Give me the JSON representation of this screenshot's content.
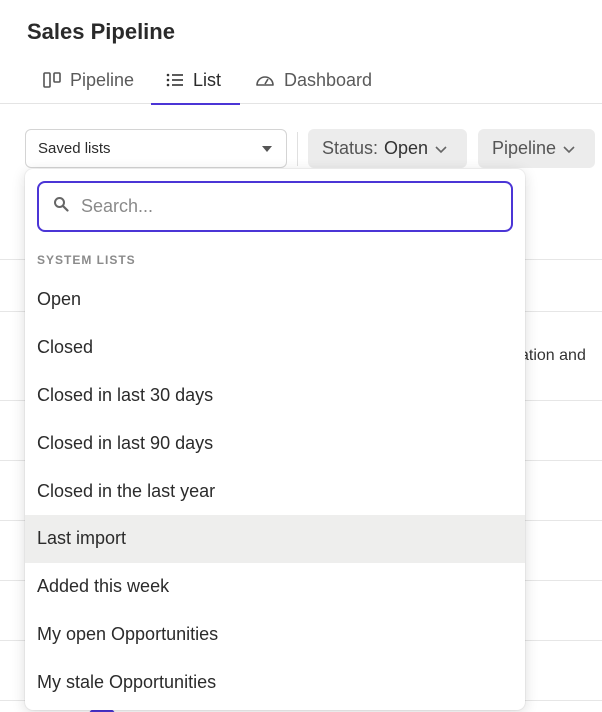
{
  "page": {
    "title": "Sales Pipeline"
  },
  "tabs": [
    {
      "label": "Pipeline",
      "icon": "board-icon",
      "active": false
    },
    {
      "label": "List",
      "icon": "list-icon",
      "active": true
    },
    {
      "label": "Dashboard",
      "icon": "gauge-icon",
      "active": false
    }
  ],
  "toolbar": {
    "saved_lists": "Saved lists",
    "status_chip": {
      "label": "Status:",
      "value": "Open"
    },
    "pipeline_chip": {
      "label": "Pipeline"
    }
  },
  "background": {
    "partial_text": "ation and"
  },
  "dropdown": {
    "search_placeholder": "Search...",
    "group_label": "SYSTEM LISTS",
    "items": [
      "Open",
      "Closed",
      "Closed in last 30 days",
      "Closed in last 90 days",
      "Closed in the last year",
      "Last import",
      "Added this week",
      "My open Opportunities",
      "My stale Opportunities"
    ],
    "highlighted_index": 5
  },
  "colors": {
    "accent": "#4b35d6",
    "chip_bg": "#ececec",
    "highlight_bg": "#eeeeed"
  }
}
